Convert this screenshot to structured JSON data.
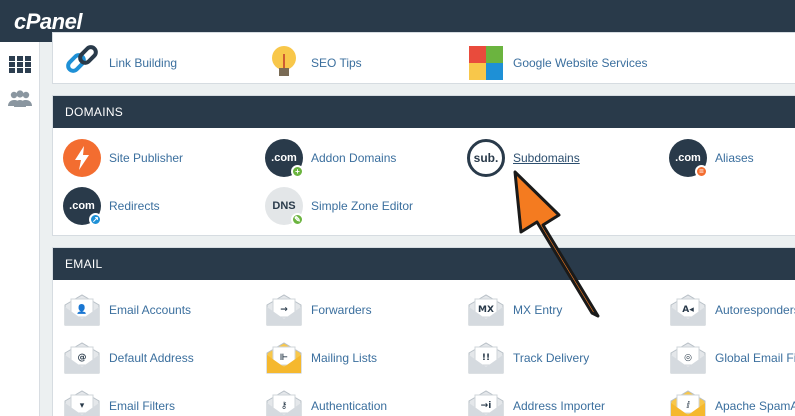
{
  "app": {
    "logo": "cPanel"
  },
  "sidebar": {
    "items": [
      {
        "icon": "grid-icon"
      },
      {
        "icon": "users-icon"
      }
    ]
  },
  "top_partial": {
    "items": [
      {
        "label": "Link Building",
        "icon": "link-icon"
      },
      {
        "label": "SEO Tips",
        "icon": "lightbulb-icon"
      },
      {
        "label": "Google Website Services",
        "icon": "puzzle-icon"
      }
    ]
  },
  "domains": {
    "title": "DOMAINS",
    "items": [
      {
        "label": "Site Publisher",
        "icon": "lightning-icon",
        "color": "#f36d30"
      },
      {
        "label": "Addon Domains",
        "icon_text": ".com",
        "color": "#293a4a",
        "badge": "+",
        "badge_color": "#6bb43f"
      },
      {
        "label": "Subdomains",
        "icon_text": "sub.",
        "color": "#ffffff"
      },
      {
        "label": "Aliases",
        "icon_text": ".com",
        "color": "#293a4a",
        "badge": "=",
        "badge_color": "#f36d30"
      },
      {
        "label": "Redirects",
        "icon_text": ".com",
        "color": "#293a4a",
        "badge": "↗",
        "badge_color": "#1e90d6"
      },
      {
        "label": "Simple Zone Editor",
        "icon_text": "DNS",
        "color": "#e3e6e8",
        "badge": "✎",
        "badge_color": "#6bb43f"
      }
    ]
  },
  "email": {
    "title": "EMAIL",
    "items": [
      {
        "label": "Email Accounts",
        "glyph": "👤"
      },
      {
        "label": "Forwarders",
        "glyph": "→"
      },
      {
        "label": "MX Entry",
        "glyph": "MX"
      },
      {
        "label": "Autoresponders",
        "glyph": "A◂"
      },
      {
        "label": "Default Address",
        "glyph": "@"
      },
      {
        "label": "Mailing Lists",
        "glyph": "⊩"
      },
      {
        "label": "Track Delivery",
        "glyph": "!!"
      },
      {
        "label": "Global Email Filt",
        "glyph": "◎"
      },
      {
        "label": "Email Filters",
        "glyph": "▾"
      },
      {
        "label": "Authentication",
        "glyph": "⚷"
      },
      {
        "label": "Address Importer",
        "glyph": "→i"
      },
      {
        "label": "Apache SpamAs",
        "glyph": "ⅈ"
      }
    ]
  },
  "colors": {
    "header": "#293a4a",
    "accent": "#f36d30",
    "link": "#3b6f9e",
    "page_bg": "#ecf0f1"
  }
}
